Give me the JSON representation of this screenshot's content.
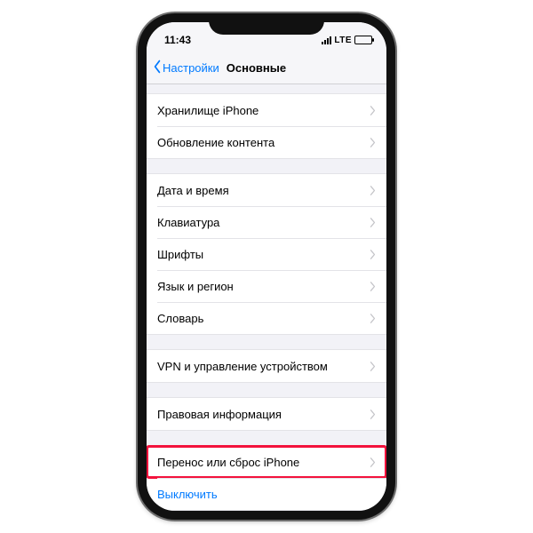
{
  "statusbar": {
    "time": "11:43",
    "network": "LTE"
  },
  "navbar": {
    "back": "Настройки",
    "title": "Основные"
  },
  "groups": [
    {
      "rows": [
        {
          "label": "Хранилище iPhone",
          "name": "settings-row-storage"
        },
        {
          "label": "Обновление контента",
          "name": "settings-row-background-refresh"
        }
      ]
    },
    {
      "rows": [
        {
          "label": "Дата и время",
          "name": "settings-row-date-time"
        },
        {
          "label": "Клавиатура",
          "name": "settings-row-keyboard"
        },
        {
          "label": "Шрифты",
          "name": "settings-row-fonts"
        },
        {
          "label": "Язык и регион",
          "name": "settings-row-language-region"
        },
        {
          "label": "Словарь",
          "name": "settings-row-dictionary"
        }
      ]
    },
    {
      "rows": [
        {
          "label": "VPN и управление устройством",
          "name": "settings-row-vpn"
        }
      ]
    },
    {
      "rows": [
        {
          "label": "Правовая информация",
          "name": "settings-row-legal"
        }
      ]
    },
    {
      "rows": [
        {
          "label": "Перенос или сброс iPhone",
          "name": "settings-row-transfer-reset",
          "highlight": true
        },
        {
          "label": "Выключить",
          "name": "settings-row-shutdown",
          "link": true,
          "noChevron": true
        }
      ]
    }
  ]
}
